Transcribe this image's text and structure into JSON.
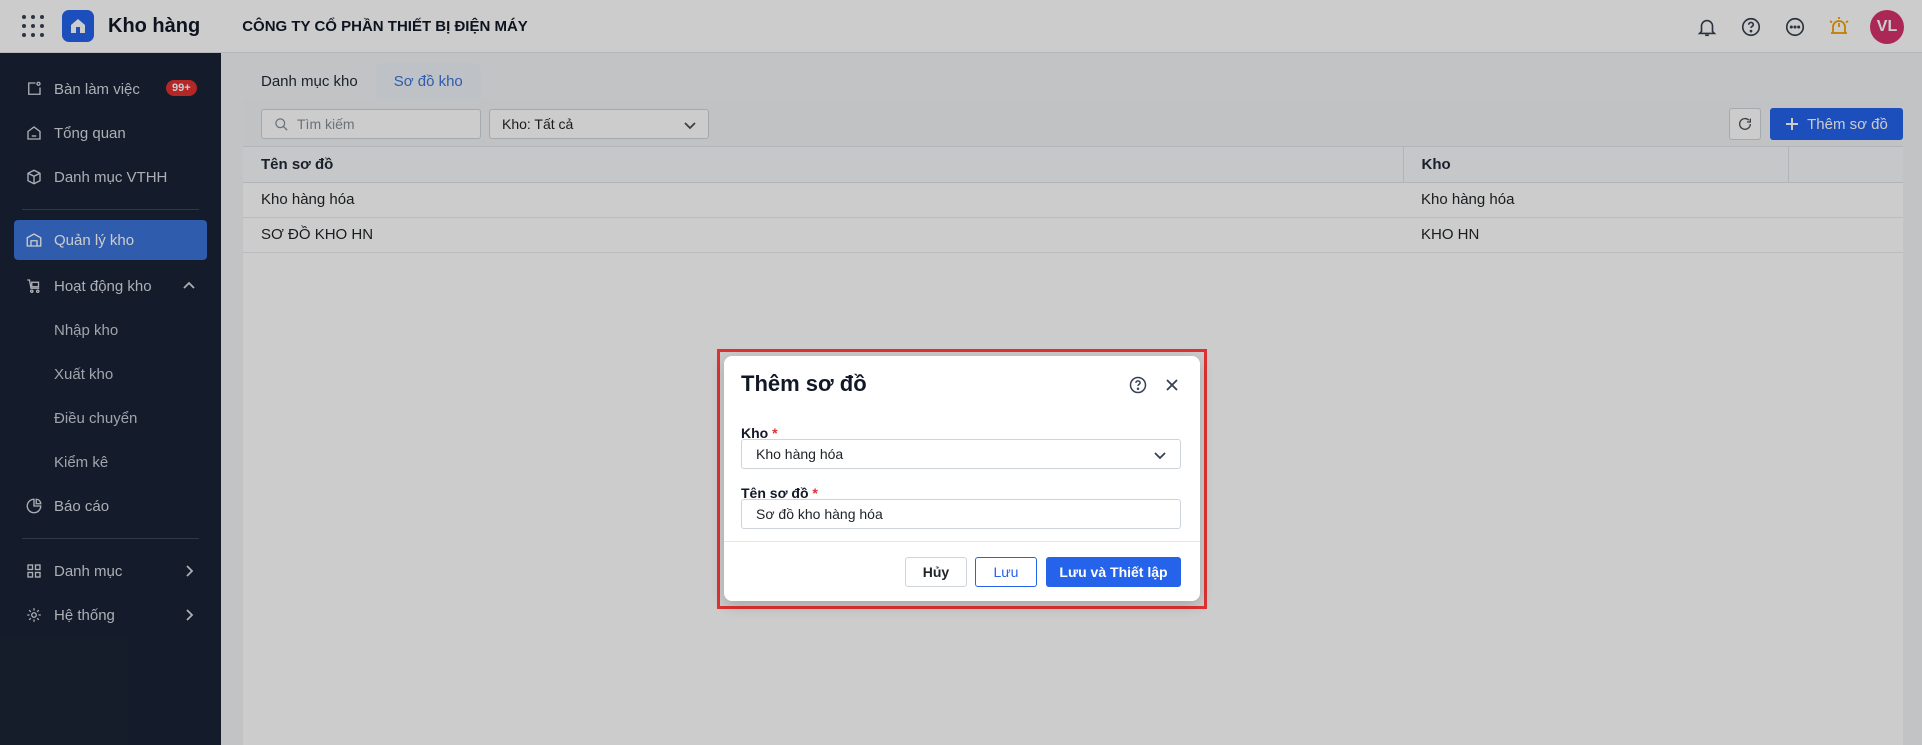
{
  "app": {
    "title": "Kho hàng",
    "company": "CÔNG TY CỔ PHẦN THIẾT BỊ ĐIỆN MÁY",
    "avatar_initials": "VL"
  },
  "sidebar": {
    "items": [
      {
        "label": "Bàn làm việc",
        "badge": "99+"
      },
      {
        "label": "Tổng quan"
      },
      {
        "label": "Danh mục VTHH"
      },
      {
        "label": "Quản lý kho"
      },
      {
        "label": "Hoạt động kho"
      },
      {
        "label": "Nhập kho"
      },
      {
        "label": "Xuất kho"
      },
      {
        "label": "Điều chuyển"
      },
      {
        "label": "Kiểm kê"
      },
      {
        "label": "Báo cáo"
      },
      {
        "label": "Danh mục"
      },
      {
        "label": "Hệ thống"
      }
    ]
  },
  "tabs": [
    {
      "label": "Danh mục kho"
    },
    {
      "label": "Sơ đồ kho"
    }
  ],
  "toolbar": {
    "search_placeholder": "Tìm kiếm",
    "filter_value": "Kho: Tất cả",
    "add_label": "Thêm sơ đồ"
  },
  "table": {
    "headers": [
      "Tên sơ đồ",
      "Kho"
    ],
    "rows": [
      [
        "Kho hàng hóa",
        "Kho hàng hóa"
      ],
      [
        "SƠ ĐỒ KHO HN",
        "KHO HN"
      ]
    ]
  },
  "dialog": {
    "title": "Thêm sơ đồ",
    "warehouse_label": "Kho",
    "warehouse_value": "Kho hàng hóa",
    "name_label": "Tên sơ đồ",
    "name_value": "Sơ đồ kho hàng hóa",
    "required_mark": "*",
    "cancel_label": "Hủy",
    "save_label": "Lưu",
    "save_setup_label": "Lưu và Thiết lập"
  },
  "colors": {
    "accent": "#2563eb",
    "sidebar_bg": "#1a2436",
    "highlight": "#e03131",
    "avatar": "#d6336c"
  }
}
